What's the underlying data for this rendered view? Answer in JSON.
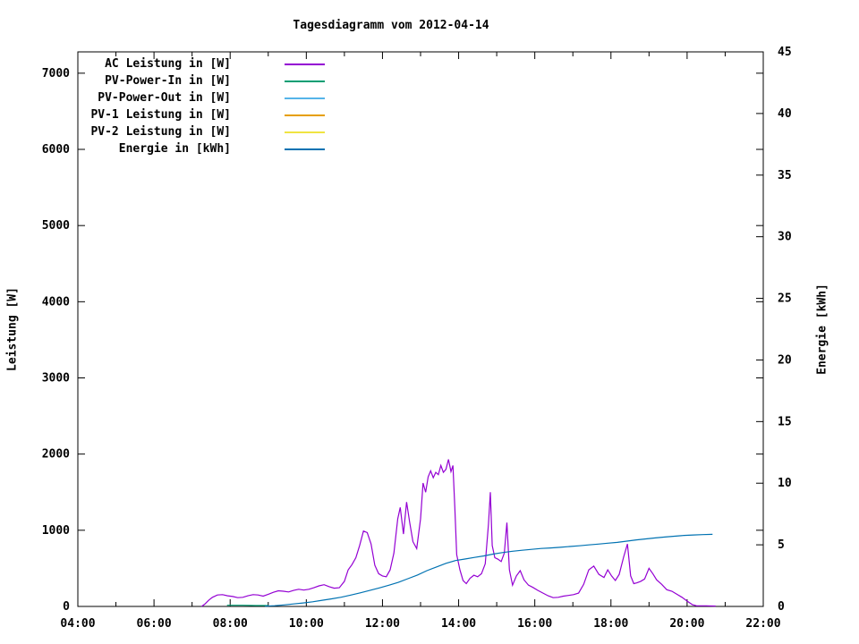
{
  "chart": {
    "title": "Tagesdiagramm vom 2012-04-14",
    "y_left_label": "Leistung [W]",
    "y_right_label": "Energie [kWh]"
  },
  "colors": {
    "background": "#ffffff",
    "text": "#000000",
    "border": "#000000",
    "ac": "#9400d3",
    "pv_power_in": "#009e73",
    "pv_power_out": "#56b4e9",
    "pv1": "#e69f00",
    "pv2": "#f0e442",
    "energie": "#0072b2"
  },
  "chart_data": {
    "type": "line",
    "title": "Tagesdiagramm vom 2012-04-14",
    "grid": false,
    "legend_position": "top-left-inside",
    "x_axis": {
      "unit": "time",
      "range_hours": [
        4,
        22
      ],
      "major_tick_every_hours": 2,
      "minor_tick_every_hours": 1,
      "tick_labels": [
        "04:00",
        "06:00",
        "08:00",
        "10:00",
        "12:00",
        "14:00",
        "16:00",
        "18:00",
        "20:00",
        "22:00"
      ]
    },
    "y_left": {
      "label": "Leistung [W]",
      "range": [
        0,
        7280
      ],
      "tick_values": [
        0,
        1000,
        2000,
        3000,
        4000,
        5000,
        6000,
        7000
      ]
    },
    "y_right": {
      "label": "Energie [kWh]",
      "range": [
        0,
        45
      ],
      "tick_values": [
        0,
        5,
        10,
        15,
        20,
        25,
        30,
        35,
        40,
        45
      ]
    },
    "legend": [
      {
        "label": "AC Leistung in [W]",
        "color": "#9400d3"
      },
      {
        "label": "PV-Power-In in [W]",
        "color": "#009e73"
      },
      {
        "label": "PV-Power-Out in [W]",
        "color": "#56b4e9"
      },
      {
        "label": "PV-1 Leistung in [W]",
        "color": "#e69f00"
      },
      {
        "label": "PV-2 Leistung in [W]",
        "color": "#f0e442"
      },
      {
        "label": "Energie in [kWh]",
        "color": "#0072b2"
      }
    ],
    "series": [
      {
        "name": "AC Leistung in [W]",
        "color": "#9400d3",
        "axis": "left",
        "points": [
          [
            "07:15",
            0
          ],
          [
            "07:20",
            30
          ],
          [
            "07:26",
            80
          ],
          [
            "07:32",
            120
          ],
          [
            "07:40",
            150
          ],
          [
            "07:48",
            155
          ],
          [
            "07:56",
            140
          ],
          [
            "08:04",
            130
          ],
          [
            "08:12",
            115
          ],
          [
            "08:20",
            120
          ],
          [
            "08:28",
            140
          ],
          [
            "08:36",
            155
          ],
          [
            "08:44",
            150
          ],
          [
            "08:52",
            135
          ],
          [
            "09:00",
            160
          ],
          [
            "09:08",
            185
          ],
          [
            "09:16",
            205
          ],
          [
            "09:24",
            200
          ],
          [
            "09:32",
            190
          ],
          [
            "09:40",
            210
          ],
          [
            "09:48",
            225
          ],
          [
            "09:56",
            215
          ],
          [
            "10:04",
            225
          ],
          [
            "10:12",
            245
          ],
          [
            "10:20",
            270
          ],
          [
            "10:28",
            285
          ],
          [
            "10:36",
            260
          ],
          [
            "10:44",
            240
          ],
          [
            "10:52",
            245
          ],
          [
            "11:00",
            330
          ],
          [
            "11:06",
            480
          ],
          [
            "11:12",
            550
          ],
          [
            "11:18",
            640
          ],
          [
            "11:24",
            800
          ],
          [
            "11:30",
            990
          ],
          [
            "11:36",
            970
          ],
          [
            "11:42",
            820
          ],
          [
            "11:48",
            540
          ],
          [
            "11:54",
            430
          ],
          [
            "12:00",
            400
          ],
          [
            "12:06",
            390
          ],
          [
            "12:12",
            480
          ],
          [
            "12:18",
            700
          ],
          [
            "12:24",
            1150
          ],
          [
            "12:28",
            1300
          ],
          [
            "12:33",
            950
          ],
          [
            "12:38",
            1370
          ],
          [
            "12:43",
            1100
          ],
          [
            "12:48",
            850
          ],
          [
            "12:54",
            760
          ],
          [
            "13:00",
            1150
          ],
          [
            "13:04",
            1620
          ],
          [
            "13:08",
            1500
          ],
          [
            "13:12",
            1700
          ],
          [
            "13:16",
            1780
          ],
          [
            "13:20",
            1690
          ],
          [
            "13:24",
            1760
          ],
          [
            "13:28",
            1730
          ],
          [
            "13:32",
            1850
          ],
          [
            "13:36",
            1760
          ],
          [
            "13:40",
            1800
          ],
          [
            "13:44",
            1930
          ],
          [
            "13:48",
            1770
          ],
          [
            "13:51",
            1850
          ],
          [
            "13:54",
            1300
          ],
          [
            "13:57",
            680
          ],
          [
            "14:02",
            480
          ],
          [
            "14:07",
            340
          ],
          [
            "14:12",
            300
          ],
          [
            "14:18",
            370
          ],
          [
            "14:24",
            410
          ],
          [
            "14:30",
            390
          ],
          [
            "14:36",
            430
          ],
          [
            "14:42",
            560
          ],
          [
            "14:47",
            1080
          ],
          [
            "14:50",
            1500
          ],
          [
            "14:53",
            800
          ],
          [
            "14:57",
            640
          ],
          [
            "15:02",
            620
          ],
          [
            "15:07",
            590
          ],
          [
            "15:12",
            700
          ],
          [
            "15:16",
            1100
          ],
          [
            "15:20",
            480
          ],
          [
            "15:25",
            280
          ],
          [
            "15:31",
            400
          ],
          [
            "15:37",
            470
          ],
          [
            "15:43",
            350
          ],
          [
            "15:50",
            280
          ],
          [
            "15:57",
            250
          ],
          [
            "16:05",
            210
          ],
          [
            "16:13",
            175
          ],
          [
            "16:21",
            140
          ],
          [
            "16:29",
            115
          ],
          [
            "16:37",
            120
          ],
          [
            "16:45",
            135
          ],
          [
            "16:53",
            145
          ],
          [
            "17:01",
            155
          ],
          [
            "17:09",
            175
          ],
          [
            "17:17",
            290
          ],
          [
            "17:25",
            480
          ],
          [
            "17:33",
            530
          ],
          [
            "17:41",
            420
          ],
          [
            "17:49",
            380
          ],
          [
            "17:55",
            480
          ],
          [
            "18:01",
            400
          ],
          [
            "18:07",
            340
          ],
          [
            "18:13",
            420
          ],
          [
            "18:20",
            650
          ],
          [
            "18:26",
            820
          ],
          [
            "18:31",
            400
          ],
          [
            "18:36",
            300
          ],
          [
            "18:41",
            310
          ],
          [
            "18:47",
            330
          ],
          [
            "18:53",
            360
          ],
          [
            "19:00",
            500
          ],
          [
            "19:06",
            430
          ],
          [
            "19:12",
            350
          ],
          [
            "19:20",
            290
          ],
          [
            "19:28",
            220
          ],
          [
            "19:36",
            200
          ],
          [
            "19:44",
            160
          ],
          [
            "19:52",
            120
          ],
          [
            "20:00",
            70
          ],
          [
            "20:08",
            25
          ],
          [
            "20:15",
            8
          ],
          [
            "20:30",
            8
          ],
          [
            "20:45",
            5
          ]
        ]
      },
      {
        "name": "PV-Power-In in [W]",
        "color": "#009e73",
        "axis": "left",
        "points": [
          [
            "07:55",
            15
          ],
          [
            "08:20",
            15
          ],
          [
            "08:40",
            12
          ],
          [
            "09:00",
            12
          ]
        ]
      },
      {
        "name": "PV-Power-Out in [W]",
        "color": "#56b4e9",
        "axis": "left",
        "points": []
      },
      {
        "name": "PV-1 Leistung in [W]",
        "color": "#e69f00",
        "axis": "left",
        "points": []
      },
      {
        "name": "PV-2 Leistung in [W]",
        "color": "#f0e442",
        "axis": "left",
        "points": []
      },
      {
        "name": "Energie in [kWh]",
        "color": "#0072b2",
        "axis": "right",
        "points": [
          [
            "08:55",
            0.02
          ],
          [
            "09:10",
            0.06
          ],
          [
            "09:25",
            0.12
          ],
          [
            "09:40",
            0.2
          ],
          [
            "09:55",
            0.28
          ],
          [
            "10:10",
            0.38
          ],
          [
            "10:25",
            0.5
          ],
          [
            "10:40",
            0.62
          ],
          [
            "10:55",
            0.75
          ],
          [
            "11:10",
            0.92
          ],
          [
            "11:25",
            1.1
          ],
          [
            "11:40",
            1.3
          ],
          [
            "11:55",
            1.5
          ],
          [
            "12:10",
            1.72
          ],
          [
            "12:25",
            1.95
          ],
          [
            "12:40",
            2.25
          ],
          [
            "12:55",
            2.55
          ],
          [
            "13:10",
            2.9
          ],
          [
            "13:25",
            3.2
          ],
          [
            "13:40",
            3.5
          ],
          [
            "13:55",
            3.72
          ],
          [
            "14:10",
            3.85
          ],
          [
            "14:25",
            3.98
          ],
          [
            "14:40",
            4.1
          ],
          [
            "14:55",
            4.25
          ],
          [
            "15:10",
            4.38
          ],
          [
            "15:25",
            4.48
          ],
          [
            "15:40",
            4.56
          ],
          [
            "15:55",
            4.63
          ],
          [
            "16:10",
            4.7
          ],
          [
            "16:25",
            4.75
          ],
          [
            "16:40",
            4.8
          ],
          [
            "16:55",
            4.86
          ],
          [
            "17:10",
            4.92
          ],
          [
            "17:25",
            4.99
          ],
          [
            "17:40",
            5.06
          ],
          [
            "17:55",
            5.13
          ],
          [
            "18:10",
            5.2
          ],
          [
            "18:25",
            5.3
          ],
          [
            "18:40",
            5.4
          ],
          [
            "18:55",
            5.48
          ],
          [
            "19:10",
            5.56
          ],
          [
            "19:25",
            5.63
          ],
          [
            "19:40",
            5.7
          ],
          [
            "19:55",
            5.76
          ],
          [
            "20:10",
            5.8
          ],
          [
            "20:25",
            5.83
          ],
          [
            "20:40",
            5.85
          ]
        ]
      }
    ]
  }
}
